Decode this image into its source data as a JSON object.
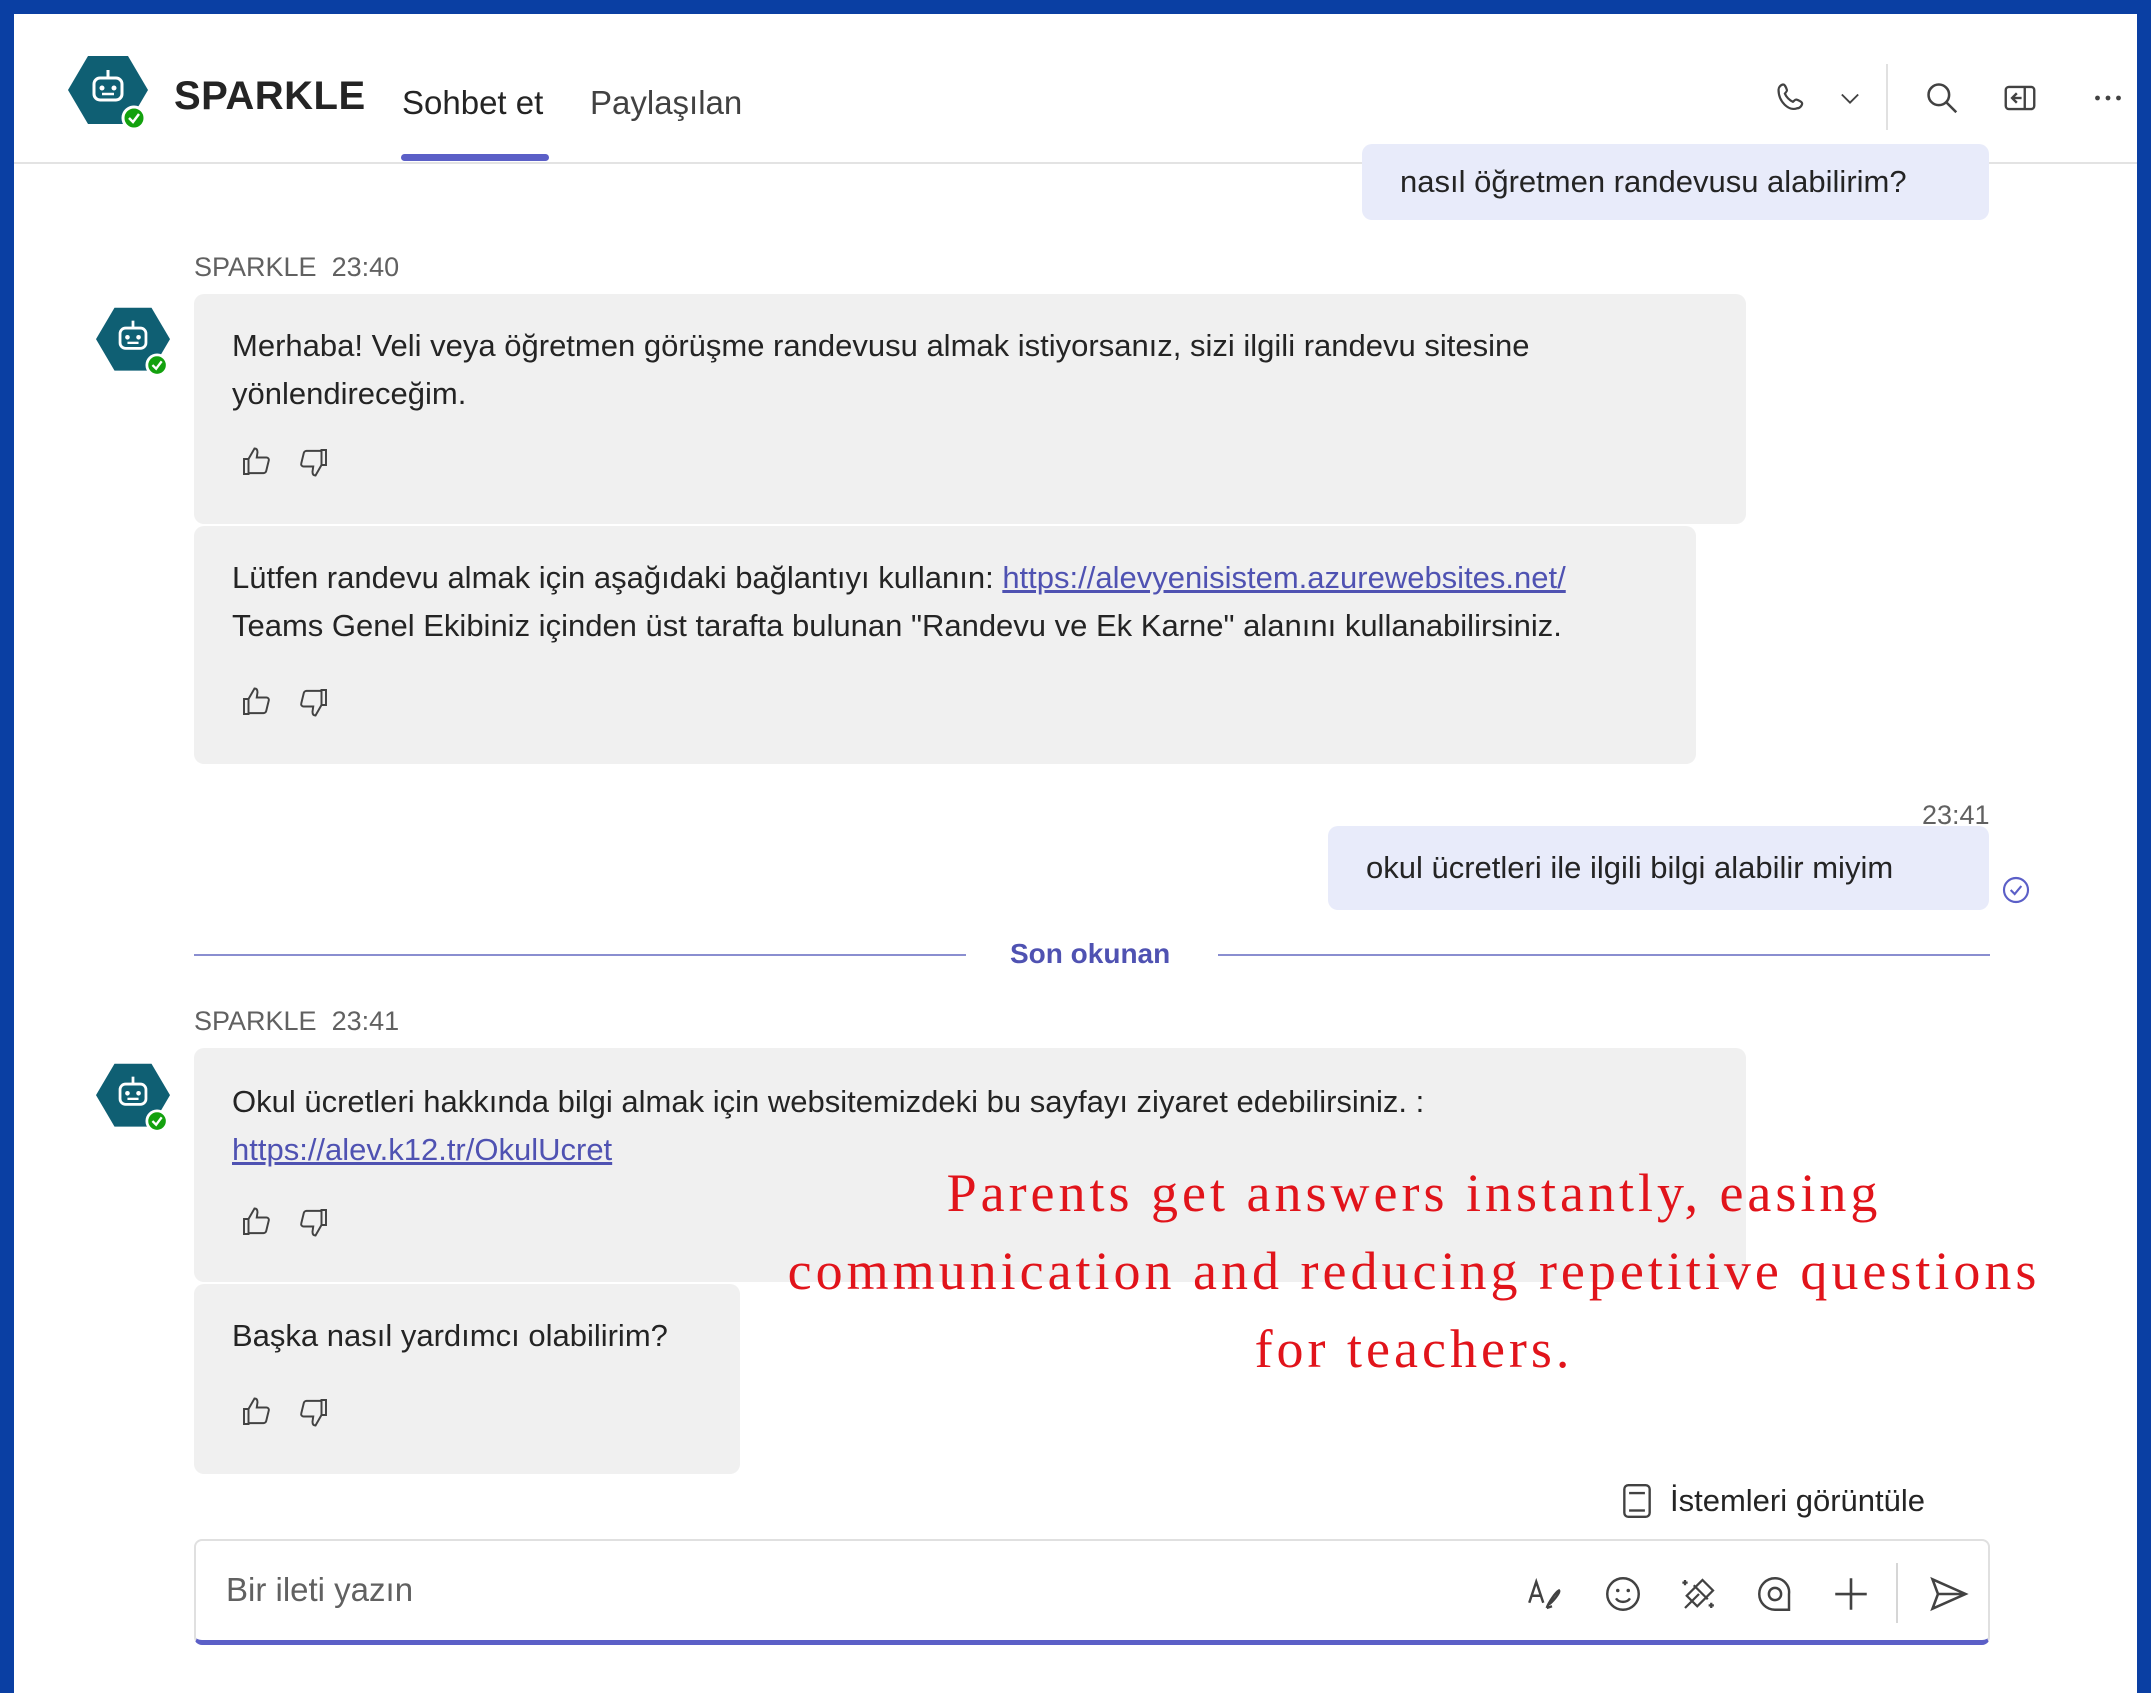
{
  "header": {
    "app_name": "SPARKLE",
    "tabs": [
      {
        "label": "Sohbet et",
        "active": true
      },
      {
        "label": "Paylaşılan",
        "active": false
      }
    ],
    "icons": [
      "phone-icon",
      "chevron-down-icon",
      "search-icon",
      "popout-icon",
      "more-icon"
    ]
  },
  "messages": {
    "prev_user_message": "nasıl  öğretmen randevusu alabilirim?",
    "bot1": {
      "sender": "SPARKLE",
      "time": "23:40",
      "text1_line1": "Merhaba! Veli veya öğretmen görüşme randevusu almak istiyorsanız, sizi ilgili randevu sitesine",
      "text1_line2": "yönlendireceğim.",
      "text2_prefix": "Lütfen randevu almak için aşağıdaki bağlantıyı kullanın: ",
      "text2_link": "https://alevyenisistem.azurewebsites.net/",
      "text2_line2": "Teams Genel Ekibiniz içinden üst tarafta bulunan \"Randevu ve Ek Karne\" alanını kullanabilirsiniz."
    },
    "user1": {
      "time": "23:41",
      "text": "okul ücretleri ile ilgili bilgi alabilir miyim"
    },
    "separator": "Son okunan",
    "bot2": {
      "sender": "SPARKLE",
      "time": "23:41",
      "text1_line1": "Okul ücretleri hakkında bilgi almak için websitemizdeki bu sayfayı ziyaret edebilirsiniz. :",
      "text1_link": "https://alev.k12.tr/OkulUcret",
      "text2": "Başka nasıl yardımcı olabilirim?"
    }
  },
  "overlay": {
    "line1": "Parents get answers instantly, easing",
    "line2": "communication and reducing repetitive questions",
    "line3": "for teachers."
  },
  "prompts_button": "İstemleri görüntüle",
  "compose": {
    "placeholder": "Bir ileti yazın",
    "icons": [
      "format-icon",
      "emoji-icon",
      "copilot-icon",
      "loop-icon",
      "add-icon",
      "send-icon"
    ]
  },
  "colors": {
    "frame": "#0a3fa3",
    "accent": "#5b5fc7",
    "bot_avatar": "#0f5f73",
    "online": "#13a10e",
    "overlay_text": "#e1141b"
  }
}
